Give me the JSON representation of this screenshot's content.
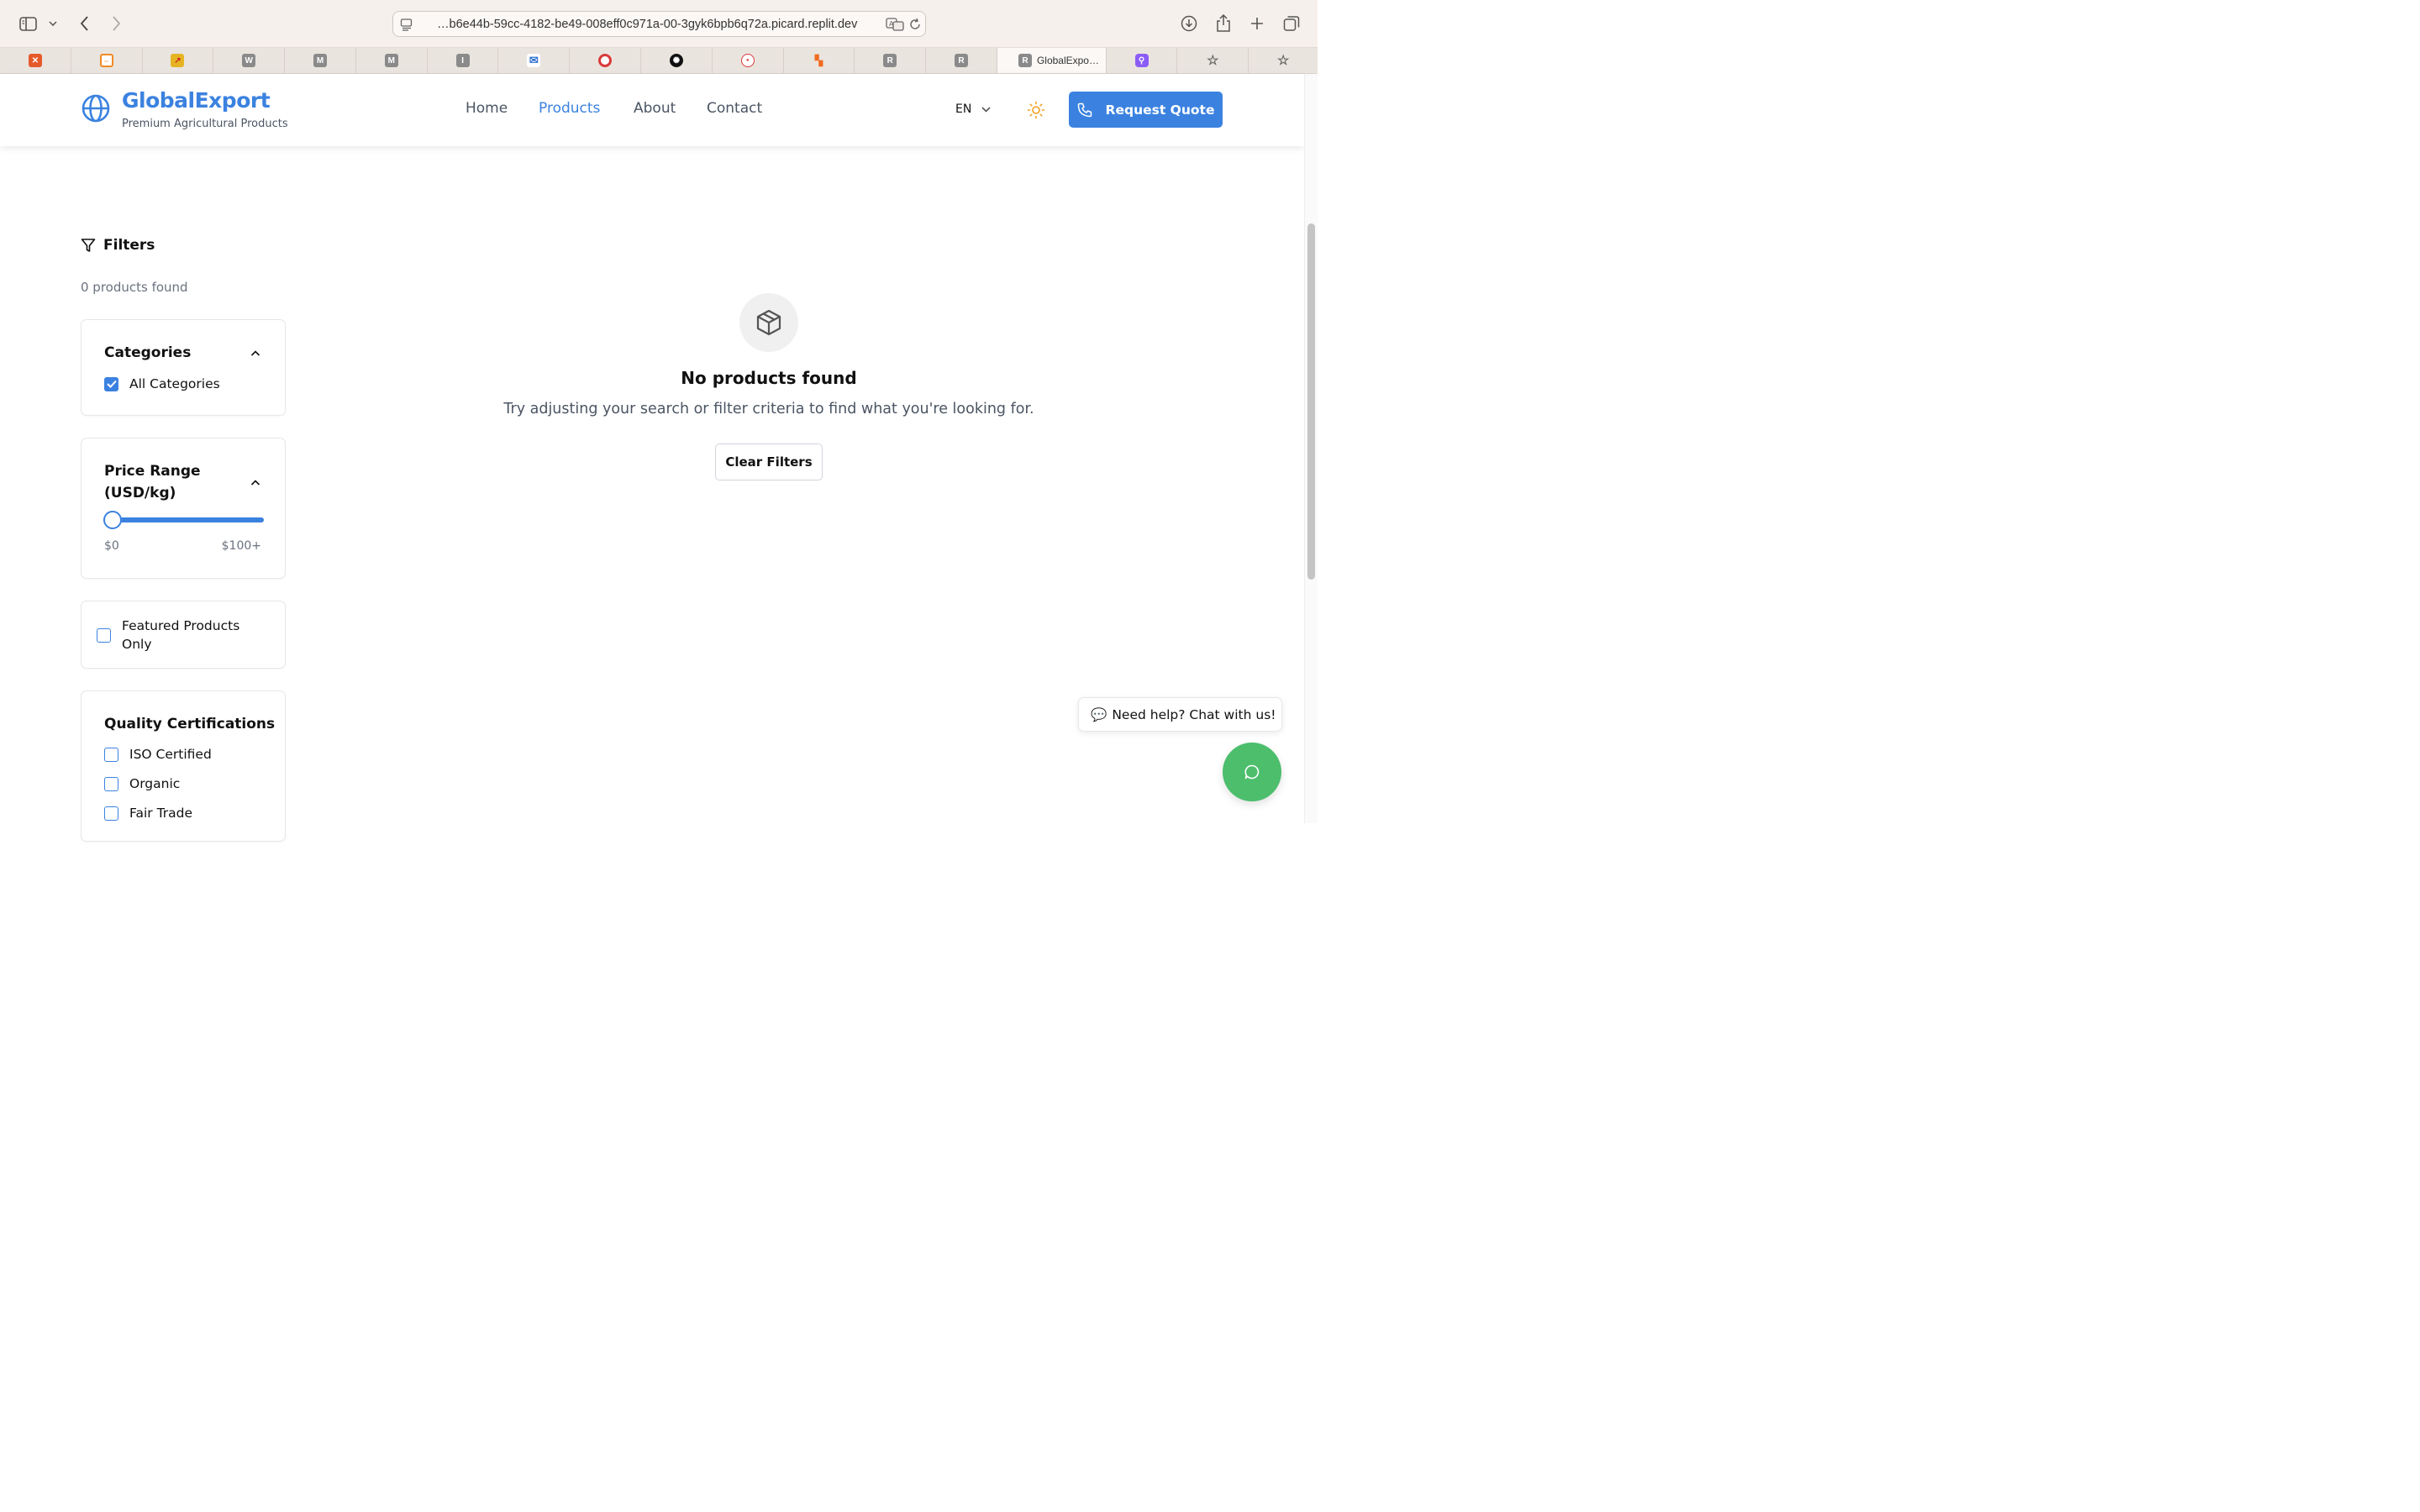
{
  "browser": {
    "url": "…b6e44b-59cc-4182-be49-008eff0c971a-00-3gyk6bpb6q72a.picard.replit.dev",
    "tabs": [
      {
        "icon": "x-icon",
        "letter": "",
        "color": "#e55a2b"
      },
      {
        "icon": "link-icon",
        "letter": "",
        "color": "#f08a24"
      },
      {
        "icon": "chart-icon",
        "letter": "",
        "color": "#e6b422"
      },
      {
        "icon": "w-icon",
        "letter": "W",
        "color": "#8a8a8a"
      },
      {
        "icon": "m-icon",
        "letter": "M",
        "color": "#8a8a8a"
      },
      {
        "icon": "m-icon",
        "letter": "M",
        "color": "#8a8a8a"
      },
      {
        "icon": "i-icon",
        "letter": "I",
        "color": "#8a8a8a"
      },
      {
        "icon": "mail-icon",
        "letter": "",
        "color": "#2f6fcf"
      },
      {
        "icon": "lifebuoy-icon",
        "letter": "",
        "color": "#d93a3a"
      },
      {
        "icon": "openai-icon",
        "letter": "",
        "color": "#111111"
      },
      {
        "icon": "brand-icon",
        "letter": "",
        "color": "#d93a3a"
      },
      {
        "icon": "blocks-icon",
        "letter": "",
        "color": "#f06a20"
      },
      {
        "icon": "r-icon",
        "letter": "R",
        "color": "#8a8a8a"
      },
      {
        "icon": "r-icon",
        "letter": "R",
        "color": "#8a8a8a"
      }
    ],
    "active_tab": {
      "letter": "R",
      "label": "GlobalExpo…"
    }
  },
  "header": {
    "brand": "GlobalExport",
    "tagline": "Premium Agricultural Products",
    "nav": [
      "Home",
      "Products",
      "About",
      "Contact"
    ],
    "active_nav": "Products",
    "lang": "EN",
    "quote_button": "Request Quote",
    "accent": "#3b82e0"
  },
  "filters": {
    "title": "Filters",
    "count": "0 products found",
    "categories": {
      "title": "Categories",
      "items": [
        {
          "label": "All Categories",
          "checked": true
        }
      ]
    },
    "price": {
      "title_line1": "Price Range",
      "title_line2": "(USD/kg)",
      "min_label": "$0",
      "max_label": "$100+"
    },
    "featured": {
      "label_line1": "Featured Products",
      "label_line2": "Only",
      "checked": false
    },
    "certifications": {
      "title": "Quality Certifications",
      "items": [
        "ISO Certified",
        "Organic",
        "Fair Trade"
      ]
    }
  },
  "empty_state": {
    "title": "No products found",
    "message": "Try adjusting your search or filter criteria to find what you're looking for.",
    "button": "Clear Filters"
  },
  "chat": {
    "emoji": "💬",
    "prompt": "Need help? Chat with us!",
    "accent": "#4cbe6c"
  }
}
